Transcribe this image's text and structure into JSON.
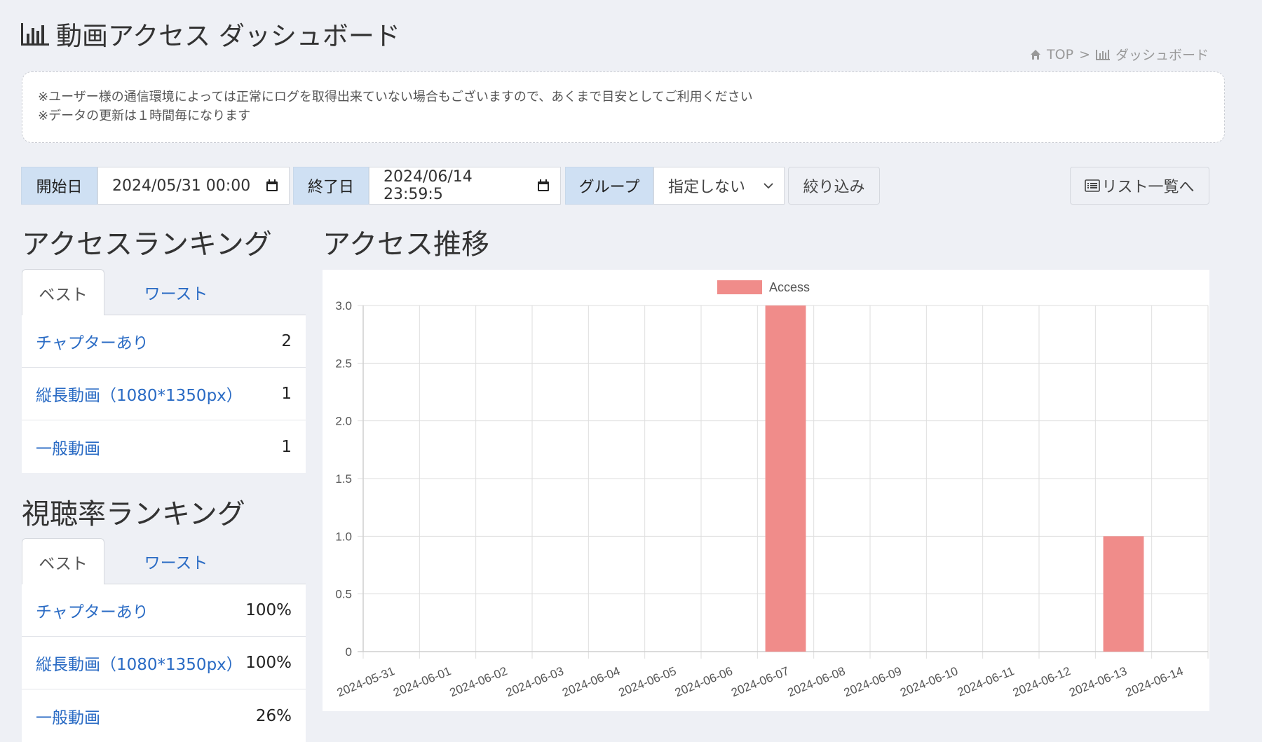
{
  "page": {
    "title": "動画アクセス ダッシュボード",
    "breadcrumb": {
      "home": "TOP",
      "sep": ">",
      "current": "ダッシュボード"
    }
  },
  "notice": {
    "line1": "※ユーザー様の通信環境によっては正常にログを取得出来ていない場合もございますので、あくまで目安としてご利用ください",
    "line2": "※データの更新は１時間毎になります"
  },
  "filters": {
    "start_label": "開始日",
    "start_value": "2024/05/31 00:00",
    "end_label": "終了日",
    "end_value": "2024/06/14 23:59:5",
    "group_label": "グループ",
    "group_value": "指定しない",
    "filter_button": "絞り込み",
    "list_button": "リスト一覧へ"
  },
  "access_ranking": {
    "title": "アクセスランキング",
    "tabs": [
      "ベスト",
      "ワースト"
    ],
    "items": [
      {
        "name": "チャプターあり",
        "value": "2"
      },
      {
        "name": "縦長動画（1080*1350px）",
        "value": "1"
      },
      {
        "name": "一般動画",
        "value": "1"
      }
    ]
  },
  "view_ranking": {
    "title": "視聴率ランキング",
    "tabs": [
      "ベスト",
      "ワースト"
    ],
    "items": [
      {
        "name": "チャプターあり",
        "value": "100%"
      },
      {
        "name": "縦長動画（1080*1350px）",
        "value": "100%"
      },
      {
        "name": "一般動画",
        "value": "26%"
      }
    ]
  },
  "access_trend": {
    "title": "アクセス推移"
  },
  "chart_data": {
    "type": "bar",
    "categories": [
      "2024-05-31",
      "2024-06-01",
      "2024-06-02",
      "2024-06-03",
      "2024-06-04",
      "2024-06-05",
      "2024-06-06",
      "2024-06-07",
      "2024-06-08",
      "2024-06-09",
      "2024-06-10",
      "2024-06-11",
      "2024-06-12",
      "2024-06-13",
      "2024-06-14"
    ],
    "series": [
      {
        "name": "Access",
        "values": [
          0,
          0,
          0,
          0,
          0,
          0,
          0,
          3,
          0,
          0,
          0,
          0,
          0,
          1,
          0
        ],
        "color": "#f08c8a"
      }
    ],
    "ylim": [
      0,
      3
    ],
    "yticks": [
      "0",
      "0.5",
      "1.0",
      "1.5",
      "2.0",
      "2.5",
      "3.0"
    ],
    "grid": true,
    "legend": "top"
  }
}
